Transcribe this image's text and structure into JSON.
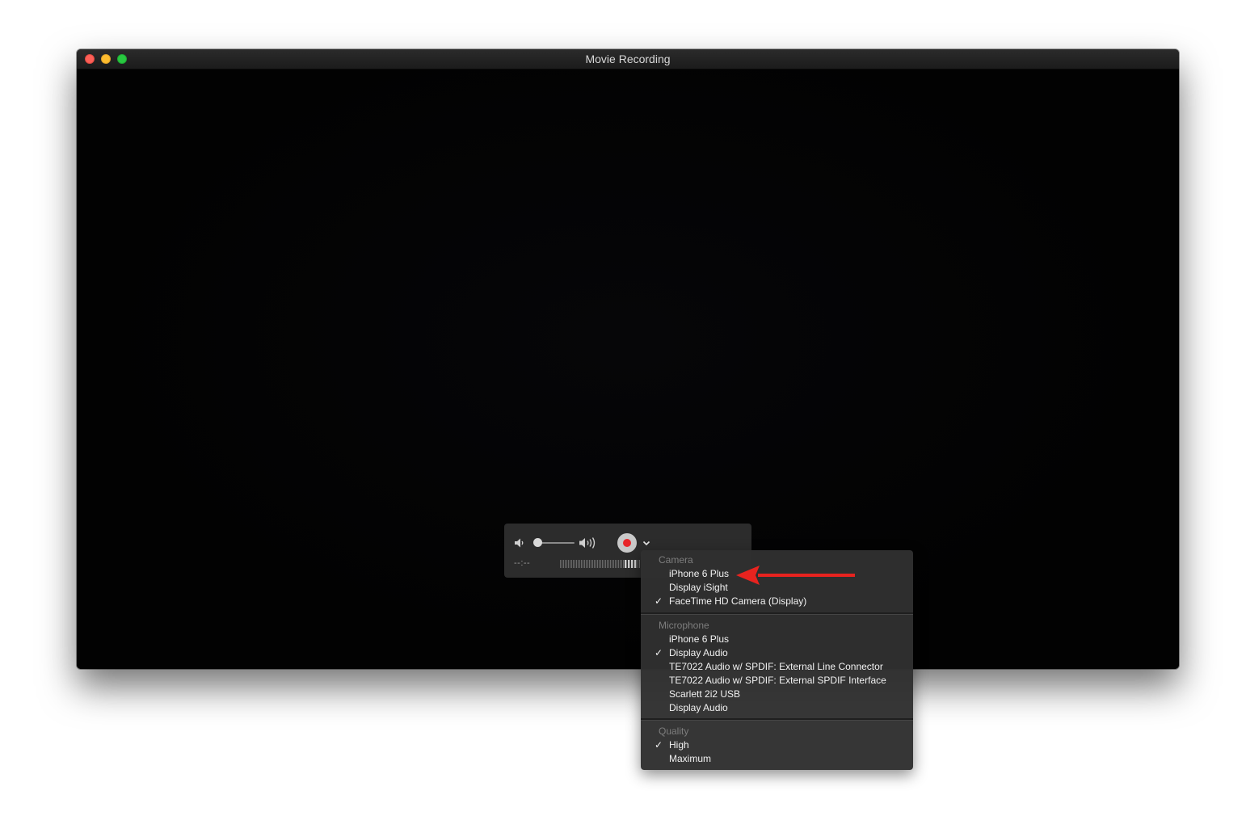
{
  "window": {
    "title": "Movie Recording"
  },
  "controls": {
    "time_display": "--:--",
    "volume_level": 0.0,
    "icons": [
      "volume-low-icon",
      "volume-high-icon",
      "record-icon",
      "chevron-down-icon"
    ]
  },
  "menu": {
    "camera": {
      "header": "Camera",
      "items": [
        {
          "label": "iPhone 6 Plus",
          "checked": false
        },
        {
          "label": "Display iSight",
          "checked": false
        },
        {
          "label": "FaceTime HD Camera (Display)",
          "checked": true
        }
      ]
    },
    "microphone": {
      "header": "Microphone",
      "items": [
        {
          "label": "iPhone 6 Plus",
          "checked": false
        },
        {
          "label": "Display Audio",
          "checked": true
        },
        {
          "label": "TE7022 Audio w/ SPDIF: External Line Connector",
          "checked": false
        },
        {
          "label": "TE7022 Audio w/ SPDIF: External SPDIF Interface",
          "checked": false
        },
        {
          "label": "Scarlett 2i2 USB",
          "checked": false
        },
        {
          "label": "Display Audio",
          "checked": false
        }
      ]
    },
    "quality": {
      "header": "Quality",
      "items": [
        {
          "label": "High",
          "checked": true
        },
        {
          "label": "Maximum",
          "checked": false
        }
      ]
    },
    "check_mark": "✓"
  },
  "colors": {
    "record": "#e8262a",
    "annotation_arrow": "#e8231f",
    "close": "#fc5f57",
    "minimize": "#fdbc2e",
    "zoom": "#28c840"
  }
}
